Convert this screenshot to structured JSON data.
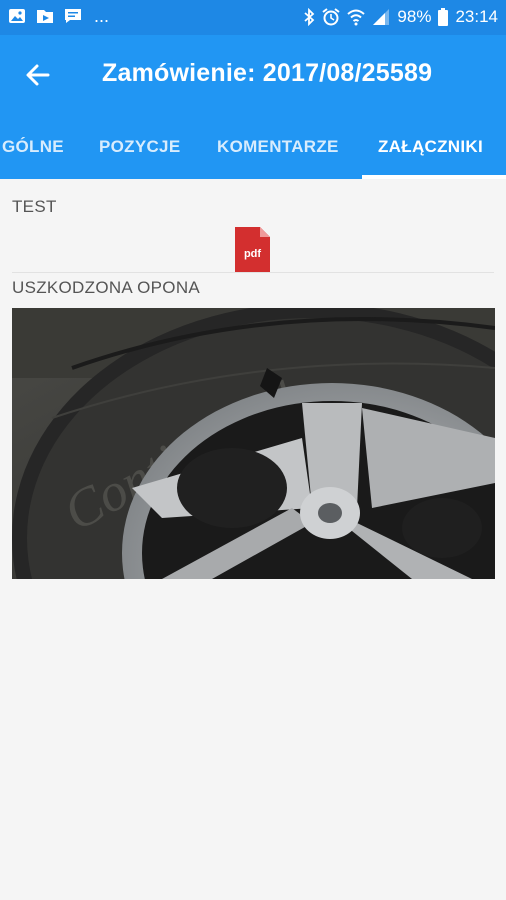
{
  "status_bar": {
    "battery_percent": "98%",
    "time": "23:14",
    "overflow": "...",
    "left_icons": [
      "gallery-icon",
      "play-store-icon",
      "message-icon"
    ],
    "right_icons": [
      "bluetooth-icon",
      "alarm-icon",
      "wifi-icon",
      "signal-icon",
      "battery-icon"
    ]
  },
  "app_bar": {
    "title": "Zamówienie: 2017/08/25589",
    "back_icon": "arrow-back-icon"
  },
  "tabs": [
    {
      "label": "GÓLNE",
      "active": false
    },
    {
      "label": "POZYCJE",
      "active": false
    },
    {
      "label": "KOMENTARZE",
      "active": false
    },
    {
      "label": "ZAŁĄCZNIKI",
      "active": true
    }
  ],
  "attachments": [
    {
      "name": "TEST",
      "type": "pdf",
      "icon_text": "pdf"
    },
    {
      "name": "USZKODZONA OPONA",
      "type": "image",
      "image_text": "Continental"
    }
  ],
  "colors": {
    "status_bar": "#1e88e5",
    "app_bar": "#2196f3",
    "pdf_icon": "#d32f2f"
  }
}
